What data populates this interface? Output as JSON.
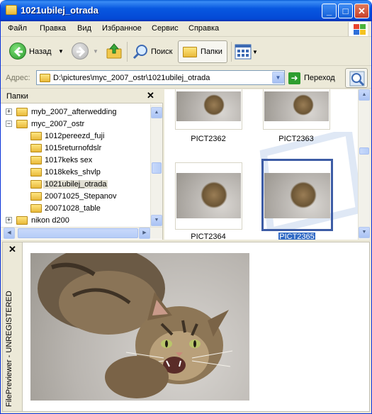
{
  "window": {
    "title": "1021ubilej_otrada",
    "min_glyph": "_",
    "max_glyph": "□",
    "close_glyph": "✕"
  },
  "menu": [
    "Файл",
    "Правка",
    "Вид",
    "Избранное",
    "Сервис",
    "Справка"
  ],
  "toolbar": {
    "back_label": "Назад",
    "search_label": "Поиск",
    "folders_label": "Папки"
  },
  "address": {
    "label": "Адрес:",
    "path": "D:\\pictures\\myc_2007_ostr\\1021ubilej_otrada",
    "go_label": "Переход"
  },
  "folders_pane": {
    "title": "Папки",
    "close_glyph": "✕",
    "tree": [
      {
        "label": "myb_2007_afterwedding",
        "expander": "+"
      },
      {
        "label": "myc_2007_ostr",
        "expander": "−"
      },
      {
        "label": "1012pereezd_fuji",
        "expander": ""
      },
      {
        "label": "1015returnofdslr",
        "expander": ""
      },
      {
        "label": "1017keks sex",
        "expander": ""
      },
      {
        "label": "1018keks_shvlp",
        "expander": ""
      },
      {
        "label": "1021ubilej_otrada",
        "expander": ""
      },
      {
        "label": "20071025_Stepanov",
        "expander": ""
      },
      {
        "label": "20071028_table",
        "expander": ""
      },
      {
        "label": "nikon d200",
        "expander": "+"
      }
    ]
  },
  "thumbnails": [
    {
      "label": "PICT2362",
      "selected": false
    },
    {
      "label": "PICT2363",
      "selected": false
    },
    {
      "label": "PICT2364",
      "selected": false
    },
    {
      "label": "PICT2365",
      "selected": true
    }
  ],
  "preview": {
    "close_glyph": "✕",
    "side_text": "FilePreviewer - UNREGISTERED"
  },
  "colors": {
    "titlebar": "#0858e0",
    "selection": "#316ac5",
    "window_bg": "#ece9d8"
  }
}
